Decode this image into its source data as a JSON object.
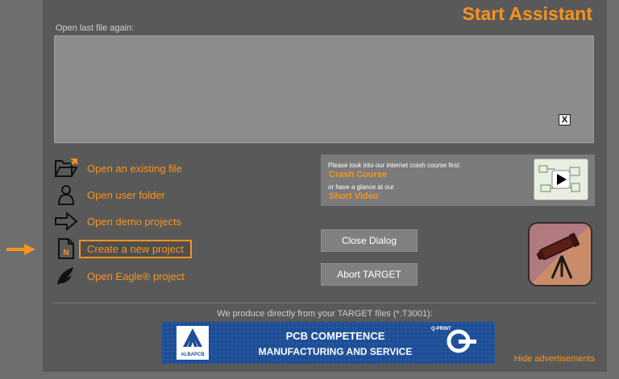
{
  "title": "Start Assistant",
  "recent": {
    "label": "Open last file again:",
    "clear_label": "X"
  },
  "actions": [
    {
      "label": "Open an existing file",
      "icon": "folder-open-icon"
    },
    {
      "label": "Open user folder",
      "icon": "user-icon"
    },
    {
      "label": "Open demo projects",
      "icon": "arrow-right-icon"
    },
    {
      "label": "Create a new project",
      "icon": "new-file-icon"
    },
    {
      "label": "Open Eagle® project",
      "icon": "eagle-icon"
    }
  ],
  "info": {
    "line1": "Please look into our internet crash course first:",
    "crash_course": "Crash Course",
    "line2": "or have a glance at our",
    "short_video": "Short Video"
  },
  "buttons": {
    "close": "Close Dialog",
    "abort": "Abort TARGET"
  },
  "ads": {
    "caption": "We produce directly from your TARGET files (*.T3001):",
    "banner_line1": "PCB COMPETENCE",
    "banner_line2": "MANUFACTURING AND SERVICE",
    "alba_logo": "ALBAPCB",
    "qprint_logo": "Q-PRINT",
    "hide": "Hide advertisements"
  },
  "colors": {
    "accent": "#f7931e",
    "dialog_bg": "#595959",
    "banner_bg": "#1e4f96"
  }
}
